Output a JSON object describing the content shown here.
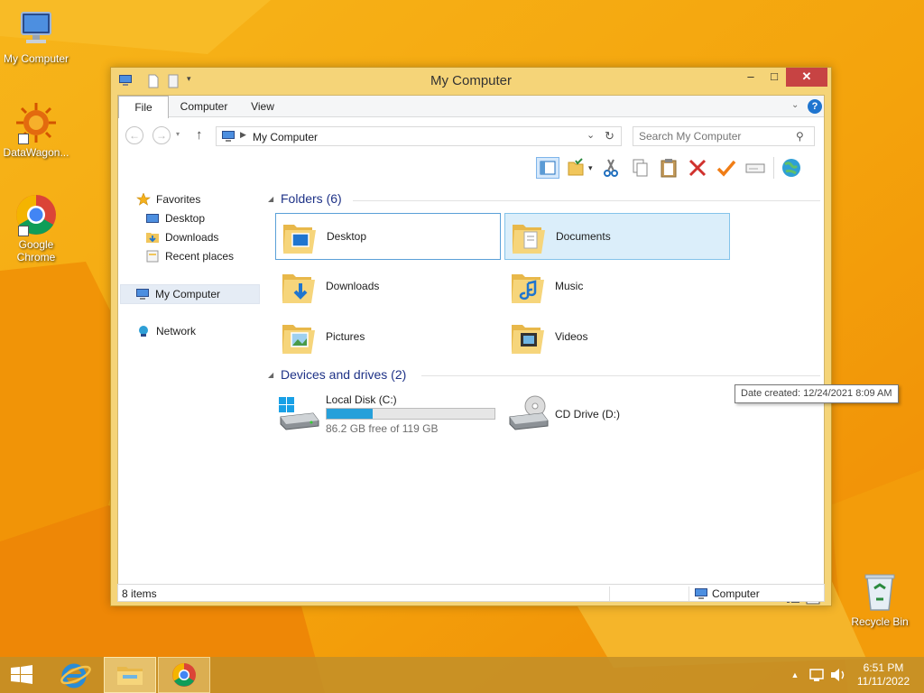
{
  "desktop": {
    "icons": [
      {
        "label": "My Computer"
      },
      {
        "label": "DataWagon..."
      },
      {
        "label": "Google Chrome"
      },
      {
        "label": "Recycle Bin"
      }
    ]
  },
  "window": {
    "title": "My Computer",
    "controls": {
      "minimize": "‒",
      "maximize": "□",
      "close": "✕"
    }
  },
  "ribbon": {
    "tabs": [
      "File",
      "Computer",
      "View"
    ],
    "help": "?"
  },
  "address": {
    "path": "My Computer",
    "search_placeholder": "Search My Computer"
  },
  "navpane": {
    "favorites": "Favorites",
    "favorites_items": [
      "Desktop",
      "Downloads",
      "Recent places"
    ],
    "my_computer": "My Computer",
    "network": "Network"
  },
  "content": {
    "folders_header": "Folders (6)",
    "folders": [
      "Desktop",
      "Documents",
      "Downloads",
      "Music",
      "Pictures",
      "Videos"
    ],
    "devices_header": "Devices and drives (2)",
    "drives": [
      {
        "name": "Local Disk (C:)",
        "free_text": "86.2 GB free of 119 GB",
        "used_fraction": 0.276
      },
      {
        "name": "CD Drive (D:)"
      }
    ],
    "tooltip": "Date created: 12/24/2021 8:09 AM",
    "items_count": "8 items"
  },
  "statusbar": {
    "left": "8 items",
    "right": "Computer"
  },
  "taskbar": {
    "time": "6:51 PM",
    "date": "11/11/2022"
  },
  "colors": {
    "desktop_orange": "#f4a70e",
    "accent_blue": "#26a0da",
    "selection_border": "#5aa0d8",
    "hover_fill": "#dbeefa",
    "close_red": "#c74343",
    "group_header": "#1e3287"
  }
}
